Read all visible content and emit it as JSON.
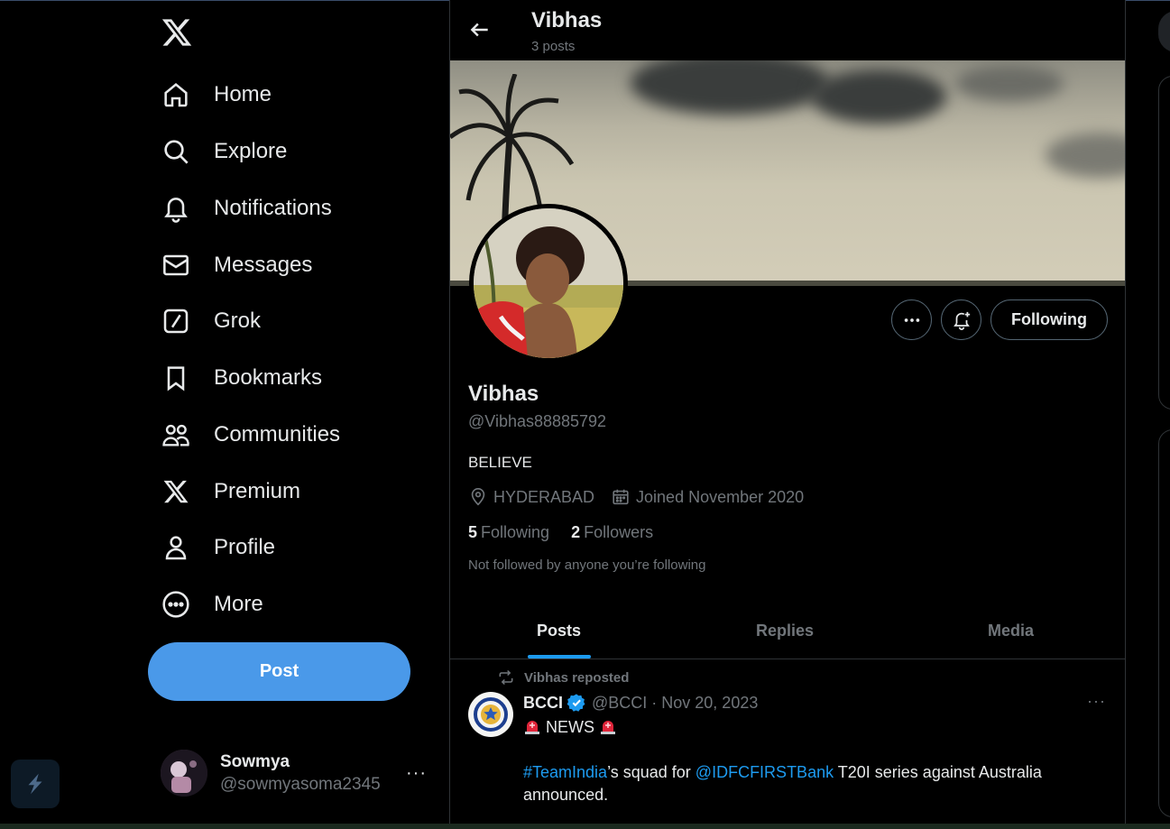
{
  "nav": {
    "items": [
      {
        "label": "Home",
        "icon": "home-icon"
      },
      {
        "label": "Explore",
        "icon": "search-icon"
      },
      {
        "label": "Notifications",
        "icon": "bell-icon"
      },
      {
        "label": "Messages",
        "icon": "envelope-icon"
      },
      {
        "label": "Grok",
        "icon": "grok-icon"
      },
      {
        "label": "Bookmarks",
        "icon": "bookmark-icon"
      },
      {
        "label": "Communities",
        "icon": "communities-icon"
      },
      {
        "label": "Premium",
        "icon": "x-logo-icon"
      },
      {
        "label": "Profile",
        "icon": "person-icon"
      },
      {
        "label": "More",
        "icon": "more-circle-icon"
      }
    ],
    "post_label": "Post"
  },
  "account": {
    "name": "Sowmya",
    "handle": "@sowmyasoma2345",
    "more": "···"
  },
  "header": {
    "name": "Vibhas",
    "post_count": "3 posts"
  },
  "profile": {
    "name": "Vibhas",
    "handle": "@Vibhas88885792",
    "bio": "BELIEVE",
    "location": "HYDERABAD",
    "joined": "Joined November 2020",
    "following_count": "5",
    "following_label": "Following",
    "followers_count": "2",
    "followers_label": "Followers",
    "note": "Not followed by anyone you’re following",
    "follow_button": "Following",
    "more_button": "···"
  },
  "tabs": [
    {
      "label": "Posts",
      "active": true
    },
    {
      "label": "Replies",
      "active": false
    },
    {
      "label": "Media",
      "active": false
    }
  ],
  "post": {
    "repost_label": "Vibhas reposted",
    "author": "BCCI",
    "verified": true,
    "handle_date": "@BCCI · Nov 20, 2023",
    "line1": "NEWS",
    "hashtag": "#TeamIndia",
    "text_a": "’s squad for ",
    "mention": "@IDFCFIRSTBank",
    "text_b": " T20I series against Australia announced.",
    "more": "···"
  },
  "colors": {
    "accent": "#1d9bf0",
    "post_button": "#4a99e9",
    "muted": "#71767b",
    "text": "#e7e9ea",
    "border": "#2f3336"
  }
}
